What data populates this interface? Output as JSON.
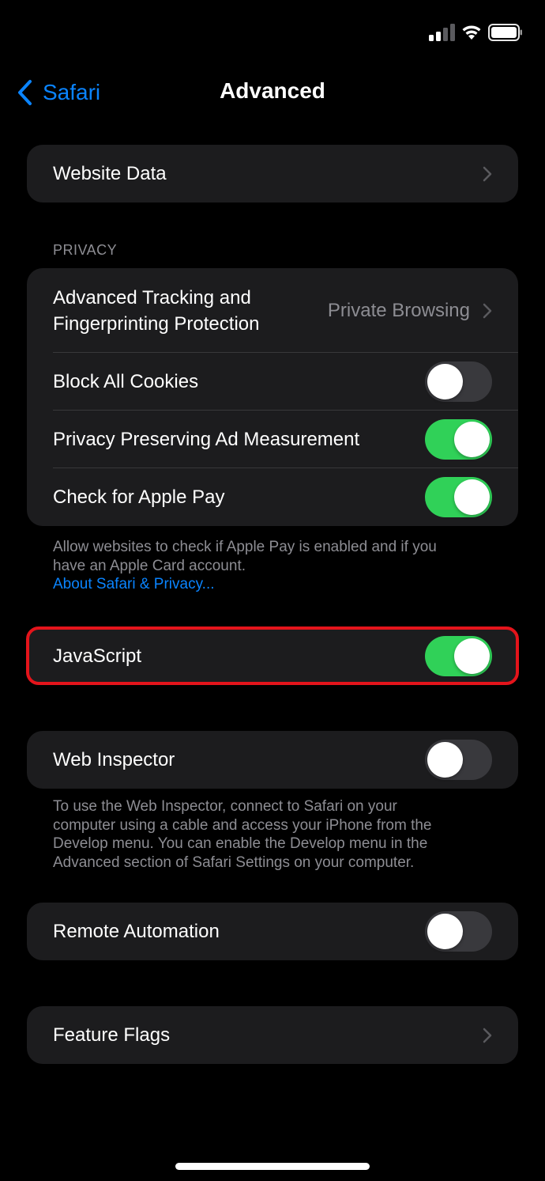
{
  "status_bar": {
    "signal_icon": "cellular-signal-icon",
    "wifi_icon": "wifi-icon",
    "battery_icon": "battery-icon"
  },
  "nav": {
    "back_label": "Safari",
    "back_icon": "chevron-left-icon",
    "title": "Advanced"
  },
  "website_data": {
    "label": "Website Data"
  },
  "privacy": {
    "header": "PRIVACY",
    "tracking_label_line1": "Advanced Tracking and",
    "tracking_label_line2": "Fingerprinting Protection",
    "tracking_value": "Private Browsing",
    "block_cookies_label": "Block All Cookies",
    "block_cookies_on": false,
    "ad_measurement_label": "Privacy Preserving Ad Measurement",
    "ad_measurement_on": true,
    "apple_pay_label": "Check for Apple Pay",
    "apple_pay_on": true,
    "footer_line1": "Allow websites to check if Apple Pay is enabled and if you",
    "footer_line2": "have an Apple Card account.",
    "footer_link": "About Safari & Privacy..."
  },
  "javascript": {
    "label": "JavaScript",
    "on": true
  },
  "web_inspector": {
    "label": "Web Inspector",
    "on": false,
    "footer_line1": "To use the Web Inspector, connect to Safari on your",
    "footer_line2": "computer using a cable and access your iPhone from the",
    "footer_line3": "Develop menu. You can enable the Develop menu in the",
    "footer_line4": "Advanced section of Safari Settings on your computer."
  },
  "remote_automation": {
    "label": "Remote Automation",
    "on": false
  },
  "feature_flags": {
    "label": "Feature Flags"
  },
  "colors": {
    "background": "#000000",
    "cell": "#1c1c1e",
    "accent_blue": "#0a84ff",
    "toggle_on": "#30d158",
    "toggle_off": "#39393d",
    "highlight_red": "#e4141b",
    "secondary_text": "#8d8d93"
  }
}
